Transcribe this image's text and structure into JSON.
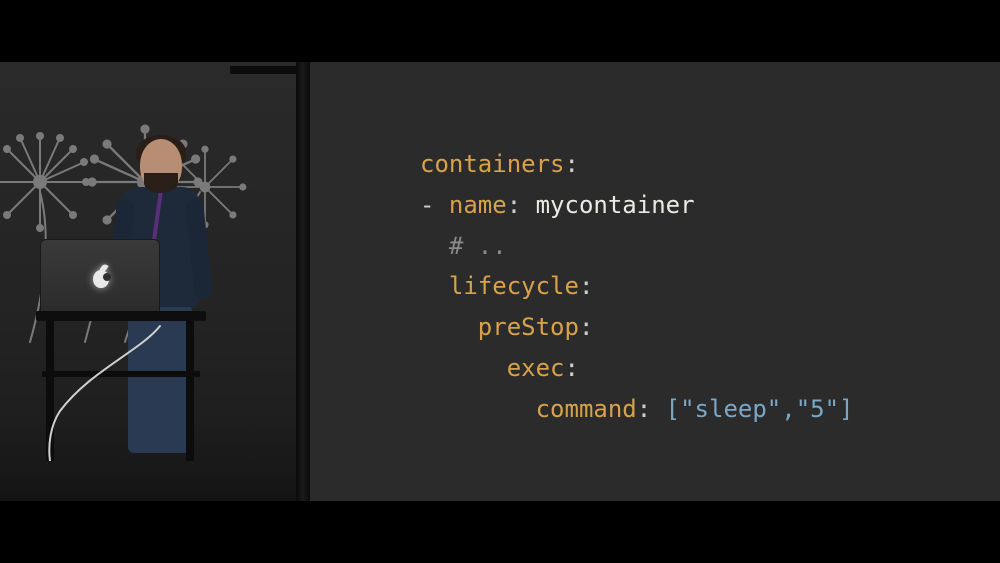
{
  "slide": {
    "code": {
      "l1_key": "containers",
      "l2_dash": "- ",
      "l2_key": "name",
      "l2_val": "mycontainer",
      "l3_comment": "# ..",
      "l4_key": "lifecycle",
      "l5_key": "preStop",
      "l6_key": "exec",
      "l7_key": "command",
      "l7_val": "[\"sleep\",\"5\"]"
    },
    "colors": {
      "bg": "#2b2b2b",
      "key": "#d9a24a",
      "string": "#eceae4",
      "comment": "#8a8a8a",
      "array": "#7aa7c7"
    }
  },
  "speaker_panel": {
    "laptop_logo": "apple-logo",
    "decor": "dandelion-wall-art"
  }
}
